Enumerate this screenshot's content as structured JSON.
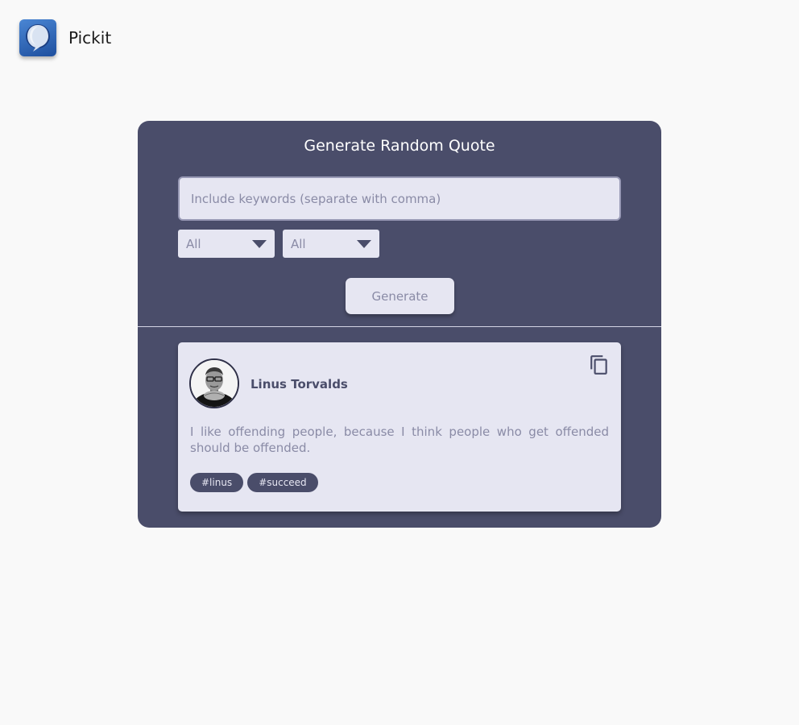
{
  "app": {
    "name": "Pickit",
    "logo_icon": "speech-bubble-icon",
    "logo_colors": [
      "#4a86d4",
      "#1e4f9e"
    ]
  },
  "generator": {
    "title": "Generate Random Quote",
    "keywords": {
      "value": "",
      "placeholder": "Include keywords (separate with comma)"
    },
    "filters": [
      {
        "selected": "All"
      },
      {
        "selected": "All"
      }
    ],
    "generate_label": "Generate"
  },
  "quote": {
    "author": "Linus Torvalds",
    "avatar_icon": "author-photo",
    "text": "I like offending people, because I think people who get offended should be offended.",
    "copy_icon": "copy-icon",
    "tags": [
      "#linus",
      "#succeed"
    ]
  },
  "colors": {
    "panel": "#4a4d6a",
    "surface": "#e6e6f2",
    "muted_text": "#8a8ba6",
    "page_background": "#f9f9f9"
  }
}
